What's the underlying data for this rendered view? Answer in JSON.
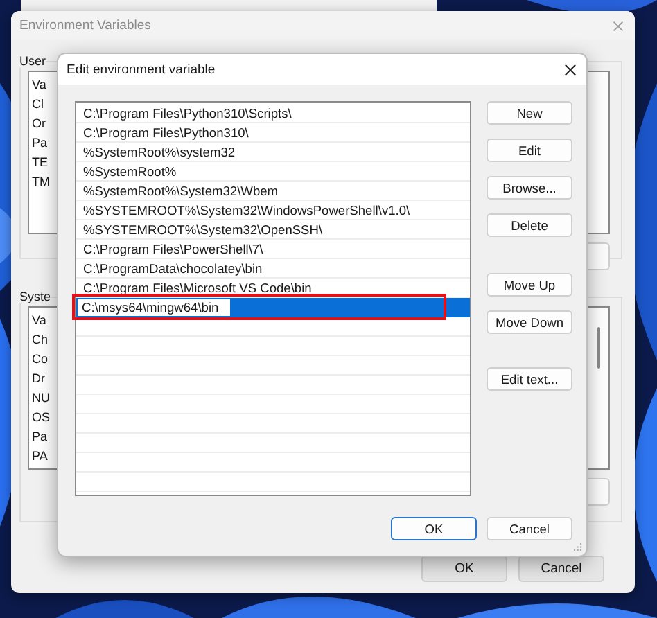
{
  "background_window": {
    "title": "Environment Variables",
    "user_group_label": "User",
    "user_list": [
      "Va",
      "Cl",
      "Or",
      "Pa",
      "TE",
      "TM"
    ],
    "system_group_label": "Syste",
    "system_list": [
      "Va",
      "Ch",
      "Co",
      "Dr",
      "NU",
      "OS",
      "Pa",
      "PA"
    ],
    "buttons": [
      "OK",
      "Cancel"
    ]
  },
  "dialog": {
    "title": "Edit environment variable",
    "entries": [
      {
        "text": "C:\\Program Files\\Python310\\Scripts\\",
        "selected": false,
        "editing": false
      },
      {
        "text": "C:\\Program Files\\Python310\\",
        "selected": false,
        "editing": false
      },
      {
        "text": "%SystemRoot%\\system32",
        "selected": false,
        "editing": false
      },
      {
        "text": "%SystemRoot%",
        "selected": false,
        "editing": false
      },
      {
        "text": "%SystemRoot%\\System32\\Wbem",
        "selected": false,
        "editing": false
      },
      {
        "text": "%SYSTEMROOT%\\System32\\WindowsPowerShell\\v1.0\\",
        "selected": false,
        "editing": false
      },
      {
        "text": "%SYSTEMROOT%\\System32\\OpenSSH\\",
        "selected": false,
        "editing": false
      },
      {
        "text": "C:\\Program Files\\PowerShell\\7\\",
        "selected": false,
        "editing": false
      },
      {
        "text": "C:\\ProgramData\\chocolatey\\bin",
        "selected": false,
        "editing": false
      },
      {
        "text": "C:\\Program Files\\Microsoft VS Code\\bin",
        "selected": false,
        "editing": false
      },
      {
        "text": "C:\\msys64\\mingw64\\bin",
        "selected": true,
        "editing": true
      }
    ],
    "button_groups": [
      [
        "New",
        "Edit",
        "Browse...",
        "Delete"
      ],
      [
        "Move Up",
        "Move Down"
      ],
      [
        "Edit text..."
      ]
    ],
    "footer_buttons": [
      {
        "label": "OK",
        "focused": true
      },
      {
        "label": "Cancel",
        "focused": false
      }
    ]
  }
}
